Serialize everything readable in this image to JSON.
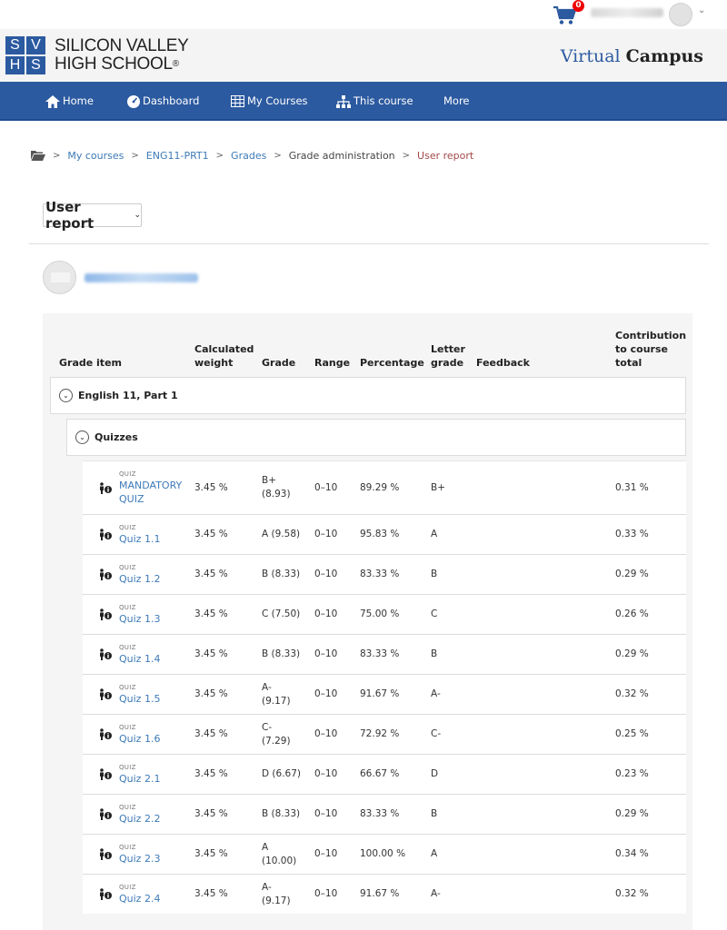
{
  "cart": {
    "count": "0"
  },
  "brand": {
    "logo_letters": [
      "S",
      "V",
      "H",
      "S"
    ],
    "line1": "SILICON VALLEY",
    "line2": "HIGH SCHOOL",
    "reg": "®",
    "virtual": "Virtual",
    "campus": "Campus",
    "color": "#2c5aa0"
  },
  "nav": {
    "home": "Home",
    "dashboard": "Dashboard",
    "my_courses": "My Courses",
    "this_course": "This course",
    "more": "More"
  },
  "breadcrumb": {
    "my_courses": "My courses",
    "course": "ENG11-PRT1",
    "grades": "Grades",
    "grade_admin": "Grade administration",
    "current": "User report"
  },
  "report_selector": {
    "value": "User report"
  },
  "table": {
    "headers": {
      "grade_item": "Grade item",
      "calc_weight_1": "Calculated",
      "calc_weight_2": "weight",
      "grade": "Grade",
      "range": "Range",
      "percentage": "Percentage",
      "letter_1": "Letter",
      "letter_2": "grade",
      "feedback": "Feedback",
      "contrib_1": "Contribution",
      "contrib_2": "to course",
      "contrib_3": "total"
    },
    "course_category": "English 11, Part 1",
    "sub_category": "Quizzes",
    "item_type": "QUIZ",
    "rows": [
      {
        "name_1": "MANDATORY",
        "name_2": "QUIZ",
        "weight": "3.45 %",
        "grade_1": "B+",
        "grade_2": "(8.93)",
        "range": "0–10",
        "percentage": "89.29 %",
        "letter": "B+",
        "contribution": "0.31 %"
      },
      {
        "name_1": "Quiz 1.1",
        "name_2": "",
        "weight": "3.45 %",
        "grade_1": "A (9.58)",
        "grade_2": "",
        "range": "0–10",
        "percentage": "95.83 %",
        "letter": "A",
        "contribution": "0.33 %"
      },
      {
        "name_1": "Quiz 1.2",
        "name_2": "",
        "weight": "3.45 %",
        "grade_1": "B (8.33)",
        "grade_2": "",
        "range": "0–10",
        "percentage": "83.33 %",
        "letter": "B",
        "contribution": "0.29 %"
      },
      {
        "name_1": "Quiz 1.3",
        "name_2": "",
        "weight": "3.45 %",
        "grade_1": "C (7.50)",
        "grade_2": "",
        "range": "0–10",
        "percentage": "75.00 %",
        "letter": "C",
        "contribution": "0.26 %"
      },
      {
        "name_1": "Quiz 1.4",
        "name_2": "",
        "weight": "3.45 %",
        "grade_1": "B (8.33)",
        "grade_2": "",
        "range": "0–10",
        "percentage": "83.33 %",
        "letter": "B",
        "contribution": "0.29 %"
      },
      {
        "name_1": "Quiz 1.5",
        "name_2": "",
        "weight": "3.45 %",
        "grade_1": "A-",
        "grade_2": "(9.17)",
        "range": "0–10",
        "percentage": "91.67 %",
        "letter": "A-",
        "contribution": "0.32 %"
      },
      {
        "name_1": "Quiz 1.6",
        "name_2": "",
        "weight": "3.45 %",
        "grade_1": "C-",
        "grade_2": "(7.29)",
        "range": "0–10",
        "percentage": "72.92 %",
        "letter": "C-",
        "contribution": "0.25 %"
      },
      {
        "name_1": "Quiz 2.1",
        "name_2": "",
        "weight": "3.45 %",
        "grade_1": "D (6.67)",
        "grade_2": "",
        "range": "0–10",
        "percentage": "66.67 %",
        "letter": "D",
        "contribution": "0.23 %"
      },
      {
        "name_1": "Quiz 2.2",
        "name_2": "",
        "weight": "3.45 %",
        "grade_1": "B (8.33)",
        "grade_2": "",
        "range": "0–10",
        "percentage": "83.33 %",
        "letter": "B",
        "contribution": "0.29 %"
      },
      {
        "name_1": "Quiz 2.3",
        "name_2": "",
        "weight": "3.45 %",
        "grade_1": "A",
        "grade_2": "(10.00)",
        "range": "0–10",
        "percentage": "100.00 %",
        "letter": "A",
        "contribution": "0.34 %"
      },
      {
        "name_1": "Quiz 2.4",
        "name_2": "",
        "weight": "3.45 %",
        "grade_1": "A-",
        "grade_2": "(9.17)",
        "range": "0–10",
        "percentage": "91.67 %",
        "letter": "A-",
        "contribution": "0.32 %"
      }
    ]
  }
}
